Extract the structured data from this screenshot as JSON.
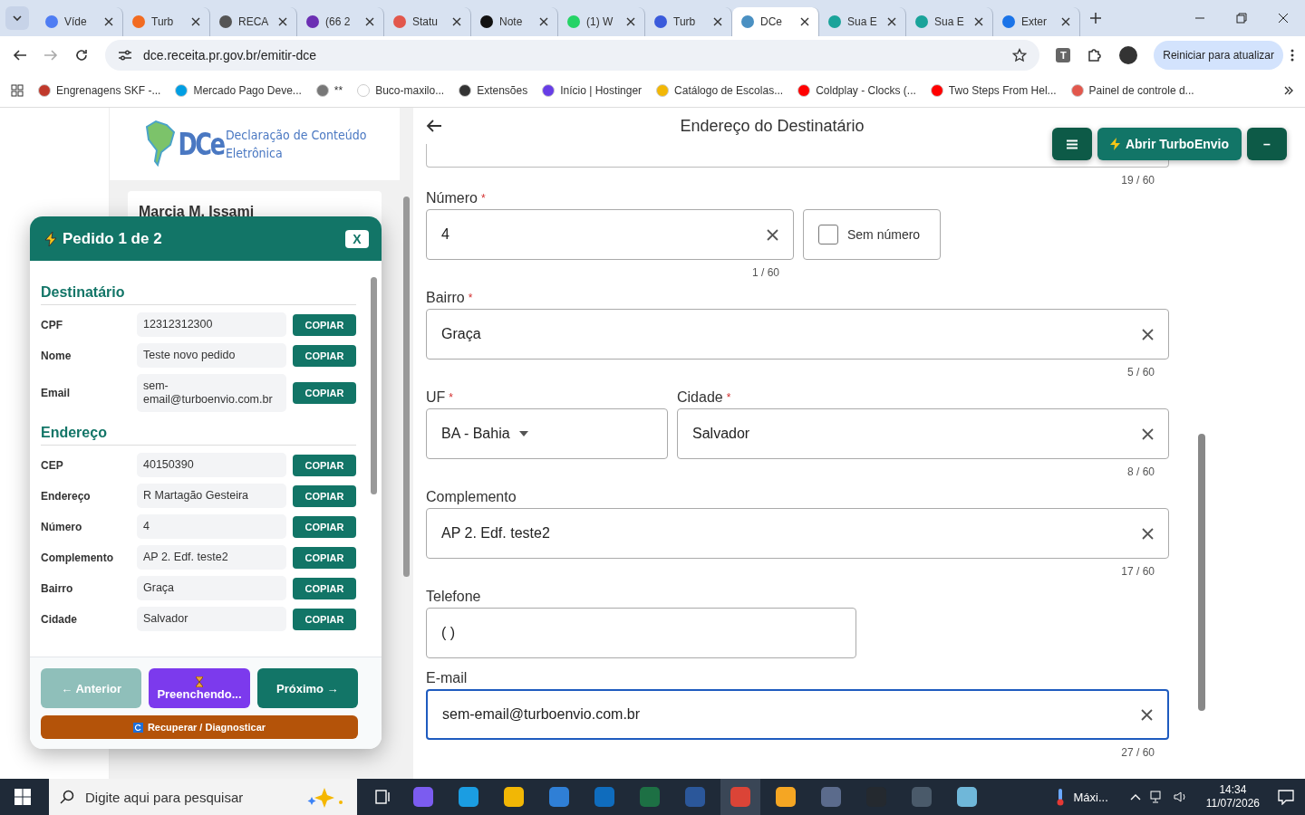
{
  "browser": {
    "tabs": [
      {
        "label": "Víde",
        "selected": false,
        "color": "#4f7df3"
      },
      {
        "label": "Turb",
        "selected": false,
        "color": "#f26b21"
      },
      {
        "label": "RECA",
        "selected": false,
        "color": "#555555"
      },
      {
        "label": "(66 2",
        "selected": false,
        "color": "#6b2fb3"
      },
      {
        "label": "Statu",
        "selected": false,
        "color": "#e2574c"
      },
      {
        "label": "Note",
        "selected": false,
        "color": "#111111"
      },
      {
        "label": "(1) W",
        "selected": false,
        "color": "#25d366"
      },
      {
        "label": "Turb",
        "selected": false,
        "color": "#3b5bdb"
      },
      {
        "label": "DCe",
        "selected": true,
        "color": "#4a90c2"
      },
      {
        "label": "Sua E",
        "selected": false,
        "color": "#1aa39a"
      },
      {
        "label": "Sua E",
        "selected": false,
        "color": "#1aa39a"
      },
      {
        "label": "Exter",
        "selected": false,
        "color": "#1a73e8"
      }
    ],
    "address": "dce.receita.pr.gov.br/emitir-dce",
    "update_button": "Reiniciar para atualizar",
    "extension_badge": "T",
    "bookmarks": [
      {
        "label": "Engrenagens SKF -...",
        "color": "#c0392b"
      },
      {
        "label": "Mercado Pago Deve...",
        "color": "#009ee3"
      },
      {
        "label": "**",
        "color": "#777777"
      },
      {
        "label": "Buco-maxilo...",
        "color": "#ffffff"
      },
      {
        "label": "Extensões",
        "color": "#333333"
      },
      {
        "label": "Início | Hostinger",
        "color": "#673de6"
      },
      {
        "label": "Catálogo de Escolas...",
        "color": "#f2b705"
      },
      {
        "label": "Coldplay - Clocks (...",
        "color": "#ff0000"
      },
      {
        "label": "Two Steps From Hel...",
        "color": "#ff0000"
      },
      {
        "label": "Painel de controle d...",
        "color": "#e2574c"
      }
    ]
  },
  "site": {
    "logo_mark": "DCe",
    "logo_title": "Declaração de Conteúdo",
    "logo_subtitle": "Eletrônica",
    "card_name": "Marcia M. Issami"
  },
  "form": {
    "title": "Endereço do Destinatário",
    "top_counter": "19 / 60",
    "rows": [
      {
        "fields": [
          {
            "kind": "text",
            "label": "Número",
            "required_mark": "*",
            "value": "4",
            "clearable": true,
            "focused": false,
            "counter": "1 / 60"
          },
          {
            "kind": "checkbox",
            "label": "Sem número",
            "checked": false
          }
        ]
      },
      {
        "fields": [
          {
            "kind": "text",
            "label": "Bairro",
            "required_mark": "*",
            "value": "Graça",
            "clearable": true,
            "focused": false,
            "counter": "5 / 60"
          }
        ]
      },
      {
        "fields": [
          {
            "kind": "select",
            "label": "UF",
            "required_mark": "*",
            "value": "BA - Bahia"
          },
          {
            "kind": "text",
            "label": "Cidade",
            "required_mark": "*",
            "value": "Salvador",
            "clearable": true,
            "focused": false,
            "counter": "8 / 60"
          }
        ]
      },
      {
        "fields": [
          {
            "kind": "text",
            "label": "Complemento",
            "value": "AP 2. Edf. teste2",
            "clearable": true,
            "focused": false,
            "counter": "17 / 60"
          }
        ]
      },
      {
        "fields": [
          {
            "kind": "phone",
            "label": "Telefone",
            "value": "(  )"
          }
        ]
      },
      {
        "fields": [
          {
            "kind": "text",
            "label": "E-mail",
            "value": "sem-email@turboenvio.com.br",
            "clearable": true,
            "focused": true,
            "counter": "27 / 60"
          }
        ]
      }
    ]
  },
  "turbo": {
    "open_label": "Abrir TurboEnvio",
    "collapse_label": "–",
    "title": "Pedido 1 de 2",
    "close": "X",
    "sections": [
      {
        "title": "Destinatário",
        "rows": [
          {
            "label": "CPF",
            "value": "12312312300",
            "button": "COPIAR"
          },
          {
            "label": "Nome",
            "value": "Teste novo pedido",
            "button": "COPIAR"
          },
          {
            "label": "Email",
            "value": "sem-email@turboenvio.com.br",
            "button": "COPIAR"
          }
        ]
      },
      {
        "title": "Endereço",
        "rows": [
          {
            "label": "CEP",
            "value": "40150390",
            "button": "COPIAR"
          },
          {
            "label": "Endereço",
            "value": "R Martagão Gesteira",
            "button": "COPIAR"
          },
          {
            "label": "Número",
            "value": "4",
            "button": "COPIAR"
          },
          {
            "label": "Complemento",
            "value": "AP 2. Edf. teste2",
            "button": "COPIAR"
          },
          {
            "label": "Bairro",
            "value": "Graça",
            "button": "COPIAR"
          },
          {
            "label": "Cidade",
            "value": "Salvador",
            "button": "COPIAR"
          }
        ]
      }
    ],
    "buttons": [
      {
        "kind": "prev",
        "label": "← Anterior",
        "disabled": true
      },
      {
        "kind": "busy",
        "label": "Preenchendo...",
        "disabled": false
      },
      {
        "kind": "next",
        "label": "Próximo →",
        "disabled": false
      }
    ],
    "recover": "Recuperar / Diagnosticar"
  },
  "taskbar": {
    "search_placeholder": "Digite aqui para pesquisar",
    "weather": "Máxi...",
    "time": "14:34",
    "date": "11/07/2026"
  }
}
